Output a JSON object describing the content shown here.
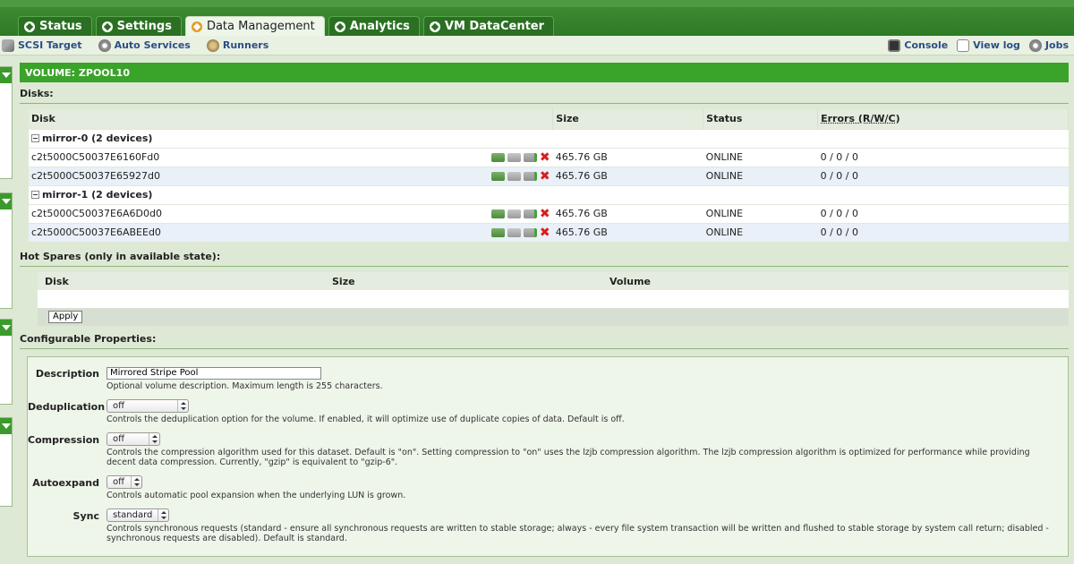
{
  "tabs": [
    {
      "label": "Status",
      "active": false
    },
    {
      "label": "Settings",
      "active": false
    },
    {
      "label": "Data Management",
      "active": true
    },
    {
      "label": "Analytics",
      "active": false
    },
    {
      "label": "VM DataCenter",
      "active": false
    }
  ],
  "subnav": {
    "left": [
      {
        "label": "SCSI Target",
        "icon": "tool-icon"
      },
      {
        "label": "Auto Services",
        "icon": "gear-icon"
      },
      {
        "label": "Runners",
        "icon": "runner-icon"
      }
    ],
    "right": [
      {
        "label": "Console",
        "icon": "console-icon"
      },
      {
        "label": "View log",
        "icon": "log-icon"
      },
      {
        "label": "Jobs",
        "icon": "gear-icon"
      }
    ]
  },
  "volume": {
    "title": "VOLUME: ZPOOL10"
  },
  "disks": {
    "section_title": "Disks:",
    "columns": [
      "Disk",
      "Size",
      "Status",
      "Errors (R/W/C)"
    ],
    "groups": [
      {
        "label": "mirror-0 (2 devices)",
        "rows": [
          {
            "disk": "c2t5000C50037E6160Fd0",
            "size": "465.76 GB",
            "status": "ONLINE",
            "errors": "0 / 0 / 0"
          },
          {
            "disk": "c2t5000C50037E65927d0",
            "size": "465.76 GB",
            "status": "ONLINE",
            "errors": "0 / 0 / 0"
          }
        ]
      },
      {
        "label": "mirror-1 (2 devices)",
        "rows": [
          {
            "disk": "c2t5000C50037E6A6D0d0",
            "size": "465.76 GB",
            "status": "ONLINE",
            "errors": "0 / 0 / 0"
          },
          {
            "disk": "c2t5000C50037E6ABEEd0",
            "size": "465.76 GB",
            "status": "ONLINE",
            "errors": "0 / 0 / 0"
          }
        ]
      }
    ]
  },
  "hot_spares": {
    "section_title": "Hot Spares (only in available state):",
    "columns": [
      "Disk",
      "Size",
      "Volume"
    ],
    "apply_label": "Apply"
  },
  "properties": {
    "section_title": "Configurable Properties:",
    "description": {
      "label": "Description",
      "value": "Mirrored Stripe Pool",
      "hint": "Optional volume description. Maximum length is 255 characters."
    },
    "deduplication": {
      "label": "Deduplication",
      "value": "off",
      "hint": "Controls the deduplication option for the volume. If enabled, it will optimize use of duplicate copies of data. Default is off."
    },
    "compression": {
      "label": "Compression",
      "value": "off",
      "hint": "Controls the compression algorithm used for this dataset. Default is \"on\". Setting compression to \"on\" uses the lzjb compression algorithm. The lzjb compression algorithm is optimized for performance while providing decent data compression. Currently, \"gzip\" is equivalent to \"gzip-6\"."
    },
    "autoexpand": {
      "label": "Autoexpand",
      "value": "off",
      "hint": "Controls automatic pool expansion when the underlying LUN is grown."
    },
    "sync": {
      "label": "Sync",
      "value": "standard",
      "hint": "Controls synchronous requests (standard - ensure all synchronous requests are written to stable storage; always - every file system transaction will be written and flushed to stable storage by system call return; disabled - synchronous requests are disabled). Default is standard."
    }
  }
}
